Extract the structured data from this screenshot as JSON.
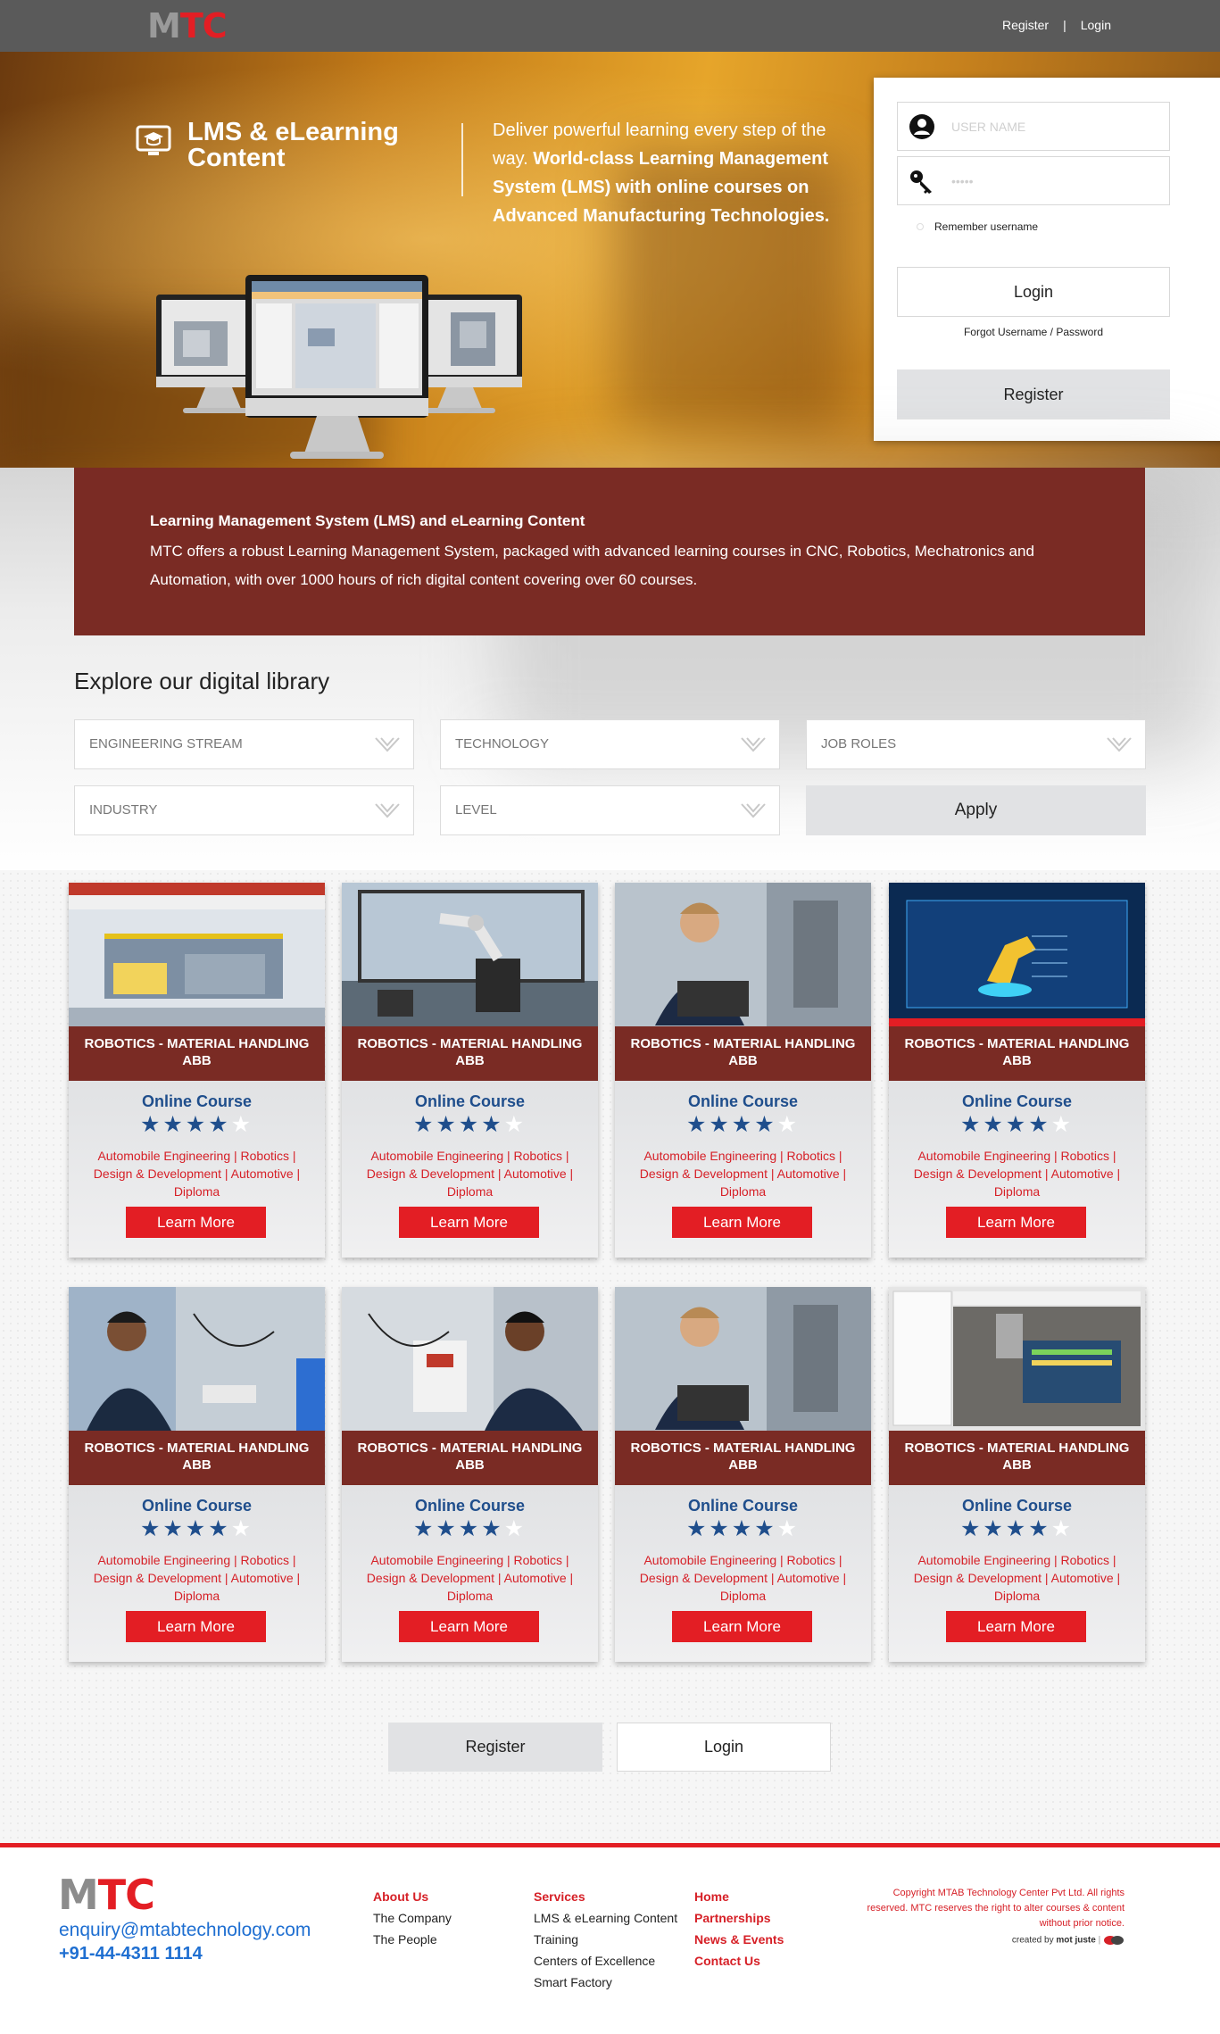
{
  "header": {
    "logo_m": "M",
    "logo_tc": "TC",
    "register_link": "Register",
    "separator": "|",
    "login_link": "Login"
  },
  "hero": {
    "icon": "monitor-graduation-icon",
    "title": "LMS & eLearning Content",
    "text_plain": "Deliver powerful learning every step of the way.",
    "text_bold": "World-class Learning Management System (LMS) with online courses on Advanced Manufacturing Technologies."
  },
  "login": {
    "username_placeholder": "USER NAME",
    "password_placeholder": "•••••",
    "remember_label": "Remember username",
    "login_button": "Login",
    "forgot_link": "Forgot Username / Password",
    "register_button": "Register"
  },
  "info": {
    "title": "Learning Management System (LMS) and eLearning Content",
    "description": "MTC offers a robust Learning Management System, packaged with advanced learning courses in CNC, Robotics, Mechatronics and Automation, with over 1000 hours of rich digital content covering over 60 courses."
  },
  "library": {
    "heading": "Explore our digital library",
    "filters": [
      "ENGINEERING STREAM",
      "TECHNOLOGY",
      "JOB ROLES",
      "INDUSTRY",
      "LEVEL"
    ],
    "apply_button": "Apply"
  },
  "courses": [
    {
      "title": "ROBOTICS - MATERIAL HANDLING ABB",
      "type": "Online Course",
      "rating": 4,
      "tags": "Automobile Engineering | Robotics | Design & Development | Automotive | Diploma",
      "button": "Learn More",
      "thumb": "software-screenshot"
    },
    {
      "title": "ROBOTICS - MATERIAL HANDLING ABB",
      "type": "Online Course",
      "rating": 4,
      "tags": "Automobile Engineering | Robotics | Design & Development | Automotive | Diploma",
      "button": "Learn More",
      "thumb": "robot-arm"
    },
    {
      "title": "ROBOTICS - MATERIAL HANDLING ABB",
      "type": "Online Course",
      "rating": 4,
      "tags": "Automobile Engineering | Robotics | Design & Development | Automotive | Diploma",
      "button": "Learn More",
      "thumb": "engineer-laptop"
    },
    {
      "title": "ROBOTICS - MATERIAL HANDLING ABB",
      "type": "Online Course",
      "rating": 4,
      "tags": "Automobile Engineering | Robotics | Design & Development | Automotive | Diploma",
      "button": "Learn More",
      "thumb": "robot-diagram"
    },
    {
      "title": "ROBOTICS - MATERIAL HANDLING ABB",
      "type": "Online Course",
      "rating": 4,
      "tags": "Automobile Engineering | Robotics | Design & Development | Automotive | Diploma",
      "button": "Learn More",
      "thumb": "student-panel"
    },
    {
      "title": "ROBOTICS - MATERIAL HANDLING ABB",
      "type": "Online Course",
      "rating": 4,
      "tags": "Automobile Engineering | Robotics | Design & Development | Automotive | Diploma",
      "button": "Learn More",
      "thumb": "student-wiring"
    },
    {
      "title": "ROBOTICS - MATERIAL HANDLING ABB",
      "type": "Online Course",
      "rating": 4,
      "tags": "Automobile Engineering | Robotics | Design & Development | Automotive | Diploma",
      "button": "Learn More",
      "thumb": "engineer-laptop"
    },
    {
      "title": "ROBOTICS - MATERIAL HANDLING ABB",
      "type": "Online Course",
      "rating": 4,
      "tags": "Automobile Engineering | Robotics | Design & Development | Automotive | Diploma",
      "button": "Learn More",
      "thumb": "cnc-simulator"
    }
  ],
  "cta": {
    "register_button": "Register",
    "login_button": "Login"
  },
  "footer": {
    "logo_m": "M",
    "logo_tc": "TC",
    "email": "enquiry@mtabtechnology.com",
    "phone": "+91-44-4311 1114",
    "col1": {
      "heading": "About Us",
      "items": [
        "The Company",
        "The People"
      ]
    },
    "col2": {
      "heading": "Services",
      "items": [
        "LMS & eLearning Content",
        "Training",
        "Centers of Excellence",
        "Smart Factory"
      ]
    },
    "col3": {
      "items": [
        "Home",
        "Partnerships",
        "News & Events",
        "Contact Us"
      ]
    },
    "copyright": "Copyright MTAB Technology Center Pvt Ltd. All rights reserved. MTC reserves the right to alter courses & content without prior notice.",
    "created_by_label": "created by",
    "created_by_name": "mot juste"
  },
  "colors": {
    "brand_red": "#e31e24",
    "maroon": "#7a2b24",
    "navy": "#1f4e8c",
    "topbar": "#5a5a5a"
  }
}
